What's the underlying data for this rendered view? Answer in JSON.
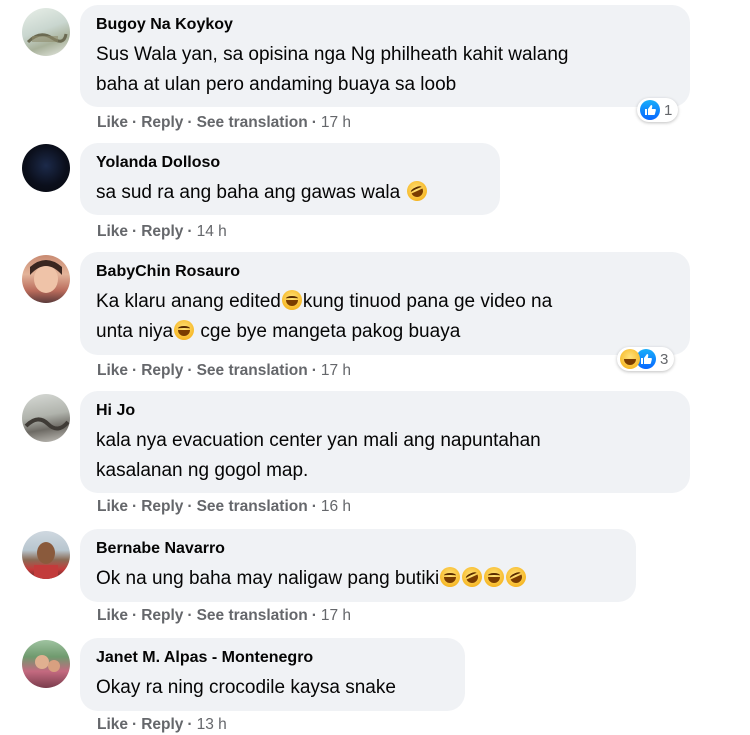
{
  "comments": [
    {
      "author": "Bugoy Na Koykoy",
      "line1": "Sus Wala yan, sa opisina nga Ng philheath kahit walang",
      "line2": "baha at ulan pero andaming buaya sa loob",
      "actions": {
        "like": "Like",
        "reply": "Reply",
        "translate": "See translation",
        "time": "17 h"
      },
      "reaction_count": "1"
    },
    {
      "author": "Yolanda Dolloso",
      "line1": "sa sud ra ang baha ang gawas wala",
      "actions": {
        "like": "Like",
        "reply": "Reply",
        "time": "14 h"
      }
    },
    {
      "author": "BabyChin Rosauro",
      "line1_a": "Ka klaru anang edited",
      "line1_b": "kung tinuod pana ge video na",
      "line2_a": "unta niya",
      "line2_b": " cge bye mangeta pakog buaya",
      "actions": {
        "like": "Like",
        "reply": "Reply",
        "translate": "See translation",
        "time": "17 h"
      },
      "reaction_count": "3"
    },
    {
      "author": "Hi Jo",
      "line1": "kala nya evacuation center yan mali ang napuntahan",
      "line2": "kasalanan ng gogol map.",
      "actions": {
        "like": "Like",
        "reply": "Reply",
        "translate": "See translation",
        "time": "16 h"
      }
    },
    {
      "author": "Bernabe Navarro",
      "line1": "Ok na ung baha may naligaw pang butiki",
      "actions": {
        "like": "Like",
        "reply": "Reply",
        "translate": "See translation",
        "time": "17 h"
      }
    },
    {
      "author": "Janet M. Alpas - Montenegro",
      "line1": "Okay ra ning crocodile kaysa snake",
      "actions": {
        "like": "Like",
        "reply": "Reply",
        "time": "13 h"
      }
    }
  ],
  "separator": "·",
  "colors": {
    "bubble": "#f0f2f5",
    "meta": "#65676b",
    "like_blue": "#0866ff"
  }
}
